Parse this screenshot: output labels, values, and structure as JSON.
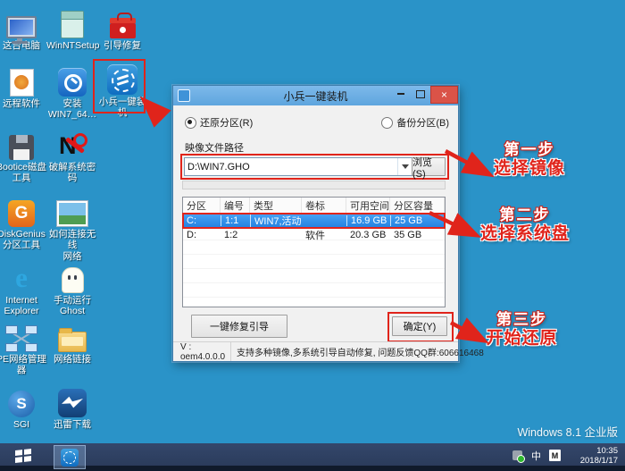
{
  "desktop": {
    "watermark": "Windows 8.1 企业版",
    "background_color": "#2a93c8",
    "accent_red": "#e0241b",
    "icons": [
      {
        "name": "this-pc",
        "label": "这台电脑"
      },
      {
        "name": "winntsetup",
        "label": "WinNTSetup"
      },
      {
        "name": "boot-repair",
        "label": "引导修复"
      },
      {
        "name": "remote-software",
        "label": "远程软件"
      },
      {
        "name": "install-win7",
        "label": "安装\nWIN7_64…"
      },
      {
        "name": "xiaobing-installer",
        "label": "小兵一键装机"
      },
      {
        "name": "bootice-disk-tool",
        "label": "Bootice磁盘\n工具"
      },
      {
        "name": "crack-system-password",
        "label": "破解系统密码"
      },
      {
        "name": "diskgenius",
        "label": "DiskGenius\n分区工具"
      },
      {
        "name": "wireless-guide",
        "label": "如何连接无线\n网络"
      },
      {
        "name": "internet-explorer",
        "label": "Internet\nExplorer"
      },
      {
        "name": "manual-ghost",
        "label": "手动运行\nGhost"
      },
      {
        "name": "pe-network-manager",
        "label": "PE网络管理器"
      },
      {
        "name": "network-links",
        "label": "网络链接"
      },
      {
        "name": "sgi",
        "label": "SGI"
      },
      {
        "name": "thunder-download",
        "label": "迅雷下载"
      }
    ],
    "icon_glyphs": {
      "nt": "N",
      "diskgenius": "G",
      "ie": "e",
      "sgi": "S"
    }
  },
  "dialog": {
    "title": "小兵一键装机",
    "close_glyph": "×",
    "radio_restore": "还原分区(R)",
    "radio_backup": "备份分区(B)",
    "path_label": "映像文件路径",
    "image_path": "D:\\WIN7.GHO",
    "browse_button": "浏览(S)",
    "table": {
      "headers": [
        "分区",
        "编号",
        "类型",
        "卷标",
        "可用空间",
        "分区容量"
      ],
      "rows": [
        {
          "cells": [
            "C:",
            "1:1",
            "WIN7,活动",
            "",
            "16.9 GB",
            "25 GB"
          ],
          "selected": true
        },
        {
          "cells": [
            "D:",
            "1:2",
            "",
            "软件",
            "20.3 GB",
            "35 GB"
          ],
          "selected": false
        }
      ]
    },
    "fix_boot_button": "一键修复引导",
    "ok_button": "确定(Y)",
    "version": "V : oem4.0.0.0",
    "status_text": "支持多种镜像,多系统引导自动修复, 问题反馈QQ群:606616468",
    "selection_color": "#2f8ef0",
    "titlebar_color": "#5ea5de"
  },
  "annotations": {
    "step1": {
      "step": "第一步",
      "action": "选择镜像"
    },
    "step2": {
      "step": "第二步",
      "action": "选择系统盘"
    },
    "step3": {
      "step": "第三步",
      "action": "开始还原"
    }
  },
  "taskbar": {
    "ime_indicator": "中",
    "ime_mode": "M",
    "time": "10:35",
    "date": "2018/1/17"
  }
}
